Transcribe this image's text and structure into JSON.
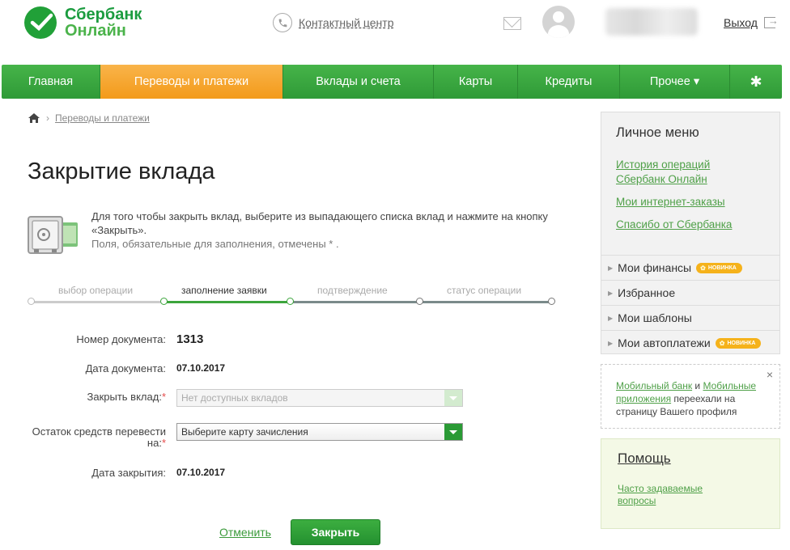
{
  "header": {
    "logo_line1": "Сбербанк",
    "logo_line2": "Онлайн",
    "contact_label": "Контактный центр",
    "logout_label": "Выход"
  },
  "nav": {
    "items": [
      {
        "label": "Главная"
      },
      {
        "label": "Переводы и платежи"
      },
      {
        "label": "Вклады и счета"
      },
      {
        "label": "Карты"
      },
      {
        "label": "Кредиты"
      },
      {
        "label": "Прочее ▾"
      }
    ],
    "active_index": 1,
    "settings_icon": "gear-icon"
  },
  "breadcrumb": {
    "link": "Переводы и платежи"
  },
  "page": {
    "title": "Закрытие вклада",
    "instruction": "Для того чтобы закрыть вклад, выберите из выпадающего списка вклад и нажмите на кнопку «Закрыть».",
    "required_note": "Поля, обязательные для заполнения, отмечены * ."
  },
  "steps": [
    {
      "label": "выбор операции",
      "state": "done"
    },
    {
      "label": "заполнение заявки",
      "state": "current"
    },
    {
      "label": "подтверждение",
      "state": "pending"
    },
    {
      "label": "статус операции",
      "state": "pending"
    }
  ],
  "form": {
    "doc_number_label": "Номер документа:",
    "doc_number": "1313",
    "doc_date_label": "Дата документа:",
    "doc_date": "07.10.2017",
    "deposit_label": "Закрыть вклад:",
    "deposit_value": "Нет доступных вкладов",
    "transfer_label_1": "Остаток средств перевести",
    "transfer_label_2": "на:",
    "transfer_value": "Выберите карту зачисления",
    "close_date_label": "Дата закрытия:",
    "close_date": "07.10.2017",
    "required_mark": "*",
    "cancel_label": "Отменить",
    "submit_label": "Закрыть"
  },
  "sidebar": {
    "title": "Личное меню",
    "links": [
      {
        "line1": "История операций",
        "line2": "Сбербанк Онлайн"
      },
      {
        "line1": "Мои интернет-заказы"
      },
      {
        "line1": "Спасибо от Сбербанка"
      }
    ],
    "rows": [
      {
        "label": "Мои финансы",
        "badge": "НОВИНКА"
      },
      {
        "label": "Избранное"
      },
      {
        "label": "Мои шаблоны"
      },
      {
        "label": "Мои автоплатежи",
        "badge": "НОВИНКА"
      }
    ]
  },
  "notice": {
    "link1": "Мобильный банк",
    "and": " и ",
    "link2a": "Мобильные",
    "link2b": "приложения",
    "text": " переехали на страницу Вашего профиля",
    "close": "×"
  },
  "help": {
    "title": "Помощь",
    "faq_line1": "Часто задаваемые",
    "faq_line2": "вопросы"
  },
  "colors": {
    "brand_green": "#2f9a37",
    "active_tab": "#f39a1a",
    "link_green": "#4fa048",
    "badge": "#f5b21b"
  }
}
